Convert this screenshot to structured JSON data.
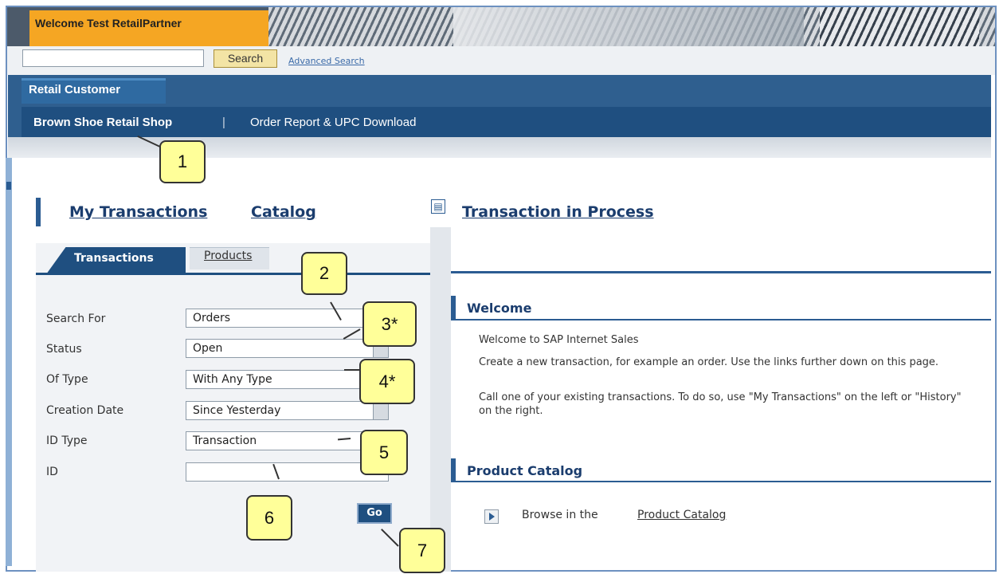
{
  "header": {
    "welcome": "Welcome Test RetailPartner"
  },
  "search": {
    "value": "",
    "button": "Search",
    "advanced_link": "Advanced Search"
  },
  "nav": {
    "tab": "Retail Customer",
    "items": [
      "Brown Shoe Retail Shop",
      "Order Report & UPC Download"
    ],
    "separator": "|"
  },
  "headings": {
    "my_transactions": "My Transactions",
    "catalog": "Catalog",
    "in_process": "Transaction in Process"
  },
  "left_panel": {
    "tabs": [
      "Transactions",
      "Products"
    ],
    "fields": [
      {
        "label": "Search For",
        "value": "Orders"
      },
      {
        "label": "Status",
        "value": "Open"
      },
      {
        "label": "Of Type",
        "value": "With Any Type"
      },
      {
        "label": "Creation Date",
        "value": "Since Yesterday"
      },
      {
        "label": "ID Type",
        "value": "Transaction"
      },
      {
        "label": "ID",
        "value": ""
      }
    ],
    "go_button": "Go"
  },
  "right_panel": {
    "welcome_title": "Welcome",
    "welcome_lines": [
      "Welcome to SAP Internet Sales",
      "Create a new transaction, for example an order. Use the links further down on this page.",
      "Call one of your existing transactions. To do so, use \"My Transactions\" on the left or \"History\" on the right."
    ],
    "catalog_title": "Product Catalog",
    "browse_text": "Browse in the",
    "browse_link": "Product Catalog"
  },
  "callouts": [
    "1",
    "2",
    "3*",
    "4*",
    "5",
    "6",
    "7"
  ],
  "colors": {
    "orange": "#f5a623",
    "navy": "#1f4f80",
    "callout": "#ffff99"
  },
  "icons": [
    "document-icon",
    "play-icon",
    "dropdown-arrow-icon"
  ]
}
